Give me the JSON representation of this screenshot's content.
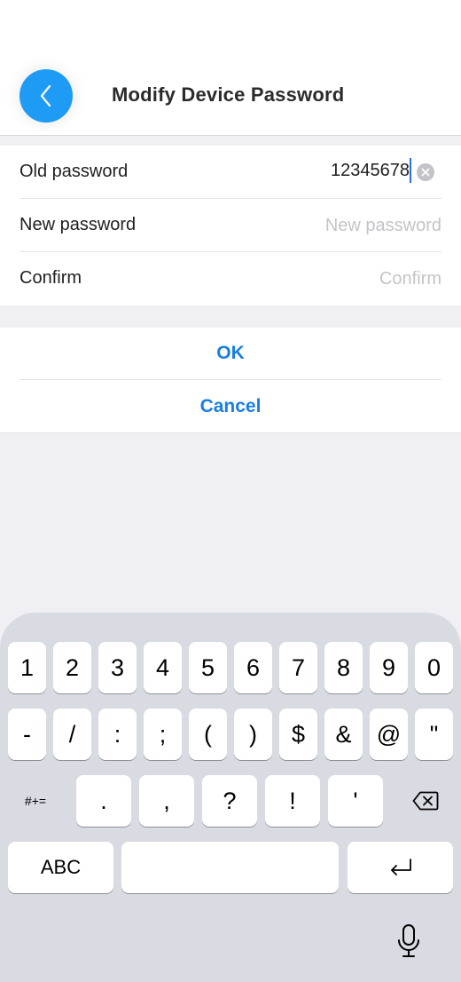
{
  "header": {
    "title": "Modify Device Password",
    "back_icon": "chevron-left-icon",
    "accent_color": "#1e9bf5"
  },
  "form": {
    "old_password": {
      "label": "Old password",
      "value": "12345678"
    },
    "new_password": {
      "label": "New password",
      "placeholder": "New password",
      "value": ""
    },
    "confirm": {
      "label": "Confirm",
      "placeholder": "Confirm",
      "value": ""
    }
  },
  "actions": {
    "ok_label": "OK",
    "cancel_label": "Cancel",
    "action_color": "#1b7fe0"
  },
  "keyboard": {
    "row1": [
      "1",
      "2",
      "3",
      "4",
      "5",
      "6",
      "7",
      "8",
      "9",
      "0"
    ],
    "row2": [
      "-",
      "/",
      ":",
      ";",
      "(",
      ")",
      "$",
      "&",
      "@",
      "\""
    ],
    "row3": [
      "#+=",
      ".",
      ",",
      "?",
      "!",
      "'"
    ],
    "abc_label": "ABC",
    "icons": [
      "delete-icon",
      "return-icon",
      "microphone-icon"
    ]
  }
}
